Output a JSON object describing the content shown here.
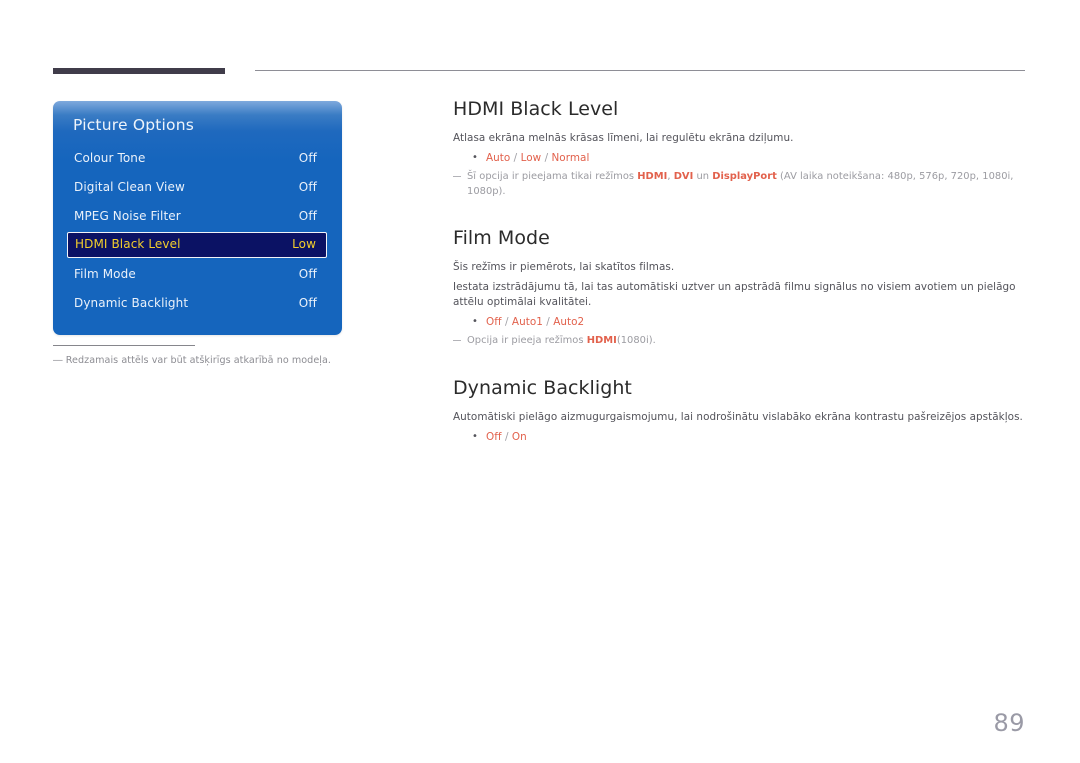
{
  "page": {
    "number": "89"
  },
  "osd": {
    "title": "Picture Options",
    "items": [
      {
        "label": "Colour Tone",
        "value": "Off",
        "selected": false
      },
      {
        "label": "Digital Clean View",
        "value": "Off",
        "selected": false
      },
      {
        "label": "MPEG Noise Filter",
        "value": "Off",
        "selected": false
      },
      {
        "label": "HDMI Black Level",
        "value": "Low",
        "selected": true
      },
      {
        "label": "Film Mode",
        "value": "Off",
        "selected": false
      },
      {
        "label": "Dynamic Backlight",
        "value": "Off",
        "selected": false
      }
    ],
    "caption": "―  Redzamais attēls var būt atšķirīgs atkarībā no modeļa."
  },
  "sections": {
    "hdmi_black_level": {
      "heading": "HDMI Black Level",
      "description": "Atlasa ekrāna melnās krāsas līmeni, lai regulētu ekrāna dziļumu.",
      "options": [
        "Auto",
        "Low",
        "Normal"
      ],
      "note_prefix": "Šī opcija ir pieejama tikai režīmos ",
      "note_terms": [
        "HDMI",
        "DVI",
        "DisplayPort"
      ],
      "note_sep1": ", ",
      "note_sep2": " un ",
      "note_suffix": " (AV laika noteikšana: 480p, 576p, 720p, 1080i, 1080p)."
    },
    "film_mode": {
      "heading": "Film Mode",
      "description1": "Šis režīms ir piemērots, lai skatītos filmas.",
      "description2": "Iestata izstrādājumu tā, lai tas automātiski uztver un apstrādā filmu signālus no visiem avotiem un pielāgo attēlu optimālai kvalitātei.",
      "options": [
        "Off",
        "Auto1",
        "Auto2"
      ],
      "note_prefix": "Opcija ir pieeja režīmos ",
      "note_term": "HDMI",
      "note_suffix": "(1080i)."
    },
    "dynamic_backlight": {
      "heading": "Dynamic Backlight",
      "description": "Automātiski pielāgo aizmugurgaismojumu, lai nodrošinātu vislabāko ekrāna kontrastu pašreizējos apstākļos.",
      "options": [
        "Off",
        "On"
      ]
    }
  },
  "colors": {
    "accent_orange": "#e2614c",
    "osd_blue": "#1565bd",
    "osd_selected_bg": "#0b1264",
    "osd_selected_text": "#f4cf2c",
    "header_bar": "#403c4a"
  }
}
